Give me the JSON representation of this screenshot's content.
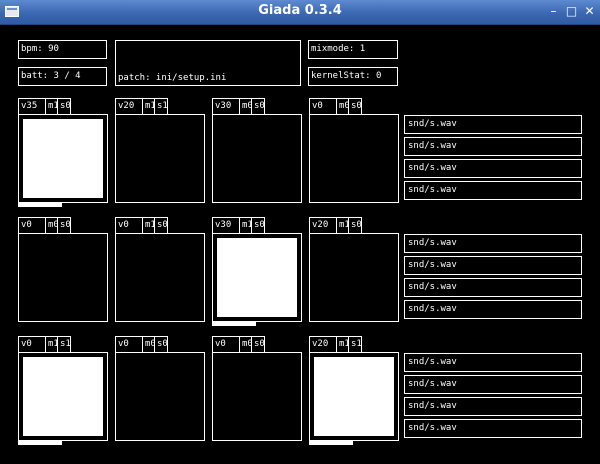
{
  "window": {
    "title": "Giada 0.3.4"
  },
  "status": {
    "bpm": "bpm: 90",
    "batt": "batt: 3 / 4",
    "patch": "patch: ini/setup.ini",
    "mixmode": "mixmode: 1",
    "kernelStat": "kernelStat: 0"
  },
  "rows": [
    {
      "channels": [
        {
          "volume": "v35",
          "mute": "m1",
          "solo": "s0",
          "active": true,
          "progress": 0.5
        },
        {
          "volume": "v20",
          "mute": "m1",
          "solo": "s1",
          "active": false,
          "progress": 0
        },
        {
          "volume": "v30",
          "mute": "m0",
          "solo": "s0",
          "active": false,
          "progress": 0
        },
        {
          "volume": "v0",
          "mute": "m0",
          "solo": "s0",
          "active": false,
          "progress": 0
        }
      ],
      "samples": [
        "snd/s.wav",
        "snd/s.wav",
        "snd/s.wav",
        "snd/s.wav"
      ]
    },
    {
      "channels": [
        {
          "volume": "v0",
          "mute": "m0",
          "solo": "s0",
          "active": false,
          "progress": 0
        },
        {
          "volume": "v0",
          "mute": "m1",
          "solo": "s0",
          "active": false,
          "progress": 0
        },
        {
          "volume": "v30",
          "mute": "m1",
          "solo": "s0",
          "active": true,
          "progress": 0.5
        },
        {
          "volume": "v20",
          "mute": "m1",
          "solo": "s0",
          "active": false,
          "progress": 0
        }
      ],
      "samples": [
        "snd/s.wav",
        "snd/s.wav",
        "snd/s.wav",
        "snd/s.wav"
      ]
    },
    {
      "channels": [
        {
          "volume": "v0",
          "mute": "m1",
          "solo": "s1",
          "active": true,
          "progress": 0.5
        },
        {
          "volume": "v0",
          "mute": "m0",
          "solo": "s0",
          "active": false,
          "progress": 0
        },
        {
          "volume": "v0",
          "mute": "m0",
          "solo": "s0",
          "active": false,
          "progress": 0
        },
        {
          "volume": "v20",
          "mute": "m1",
          "solo": "s1",
          "active": true,
          "progress": 0.5
        }
      ],
      "samples": [
        "snd/s.wav",
        "snd/s.wav",
        "snd/s.wav",
        "snd/s.wav"
      ]
    }
  ]
}
